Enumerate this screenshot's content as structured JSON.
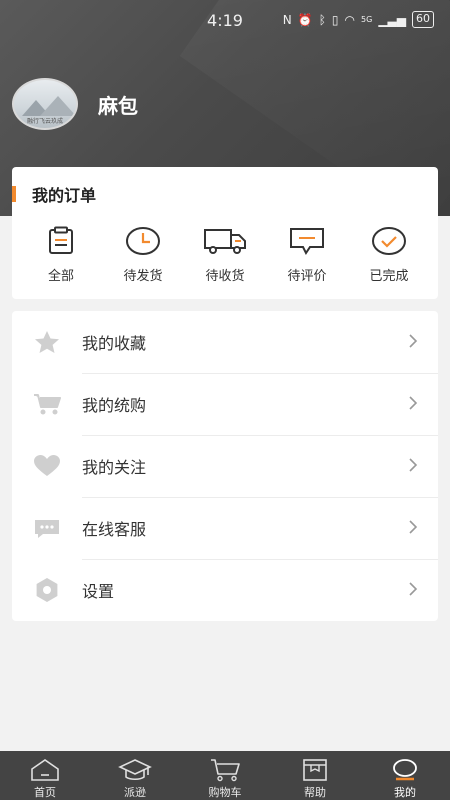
{
  "status_bar": {
    "time": "4:19",
    "network": "5G",
    "battery": "60"
  },
  "profile": {
    "avatar_caption": "融行飞云玖成",
    "username": "麻包"
  },
  "orders": {
    "title": "我的订单",
    "items": [
      {
        "label": "全部",
        "icon": "clipboard-icon"
      },
      {
        "label": "待发货",
        "icon": "clock-icon"
      },
      {
        "label": "待收货",
        "icon": "truck-icon"
      },
      {
        "label": "待评价",
        "icon": "comment-icon"
      },
      {
        "label": "已完成",
        "icon": "check-circle-icon"
      }
    ]
  },
  "menu": {
    "items": [
      {
        "label": "我的收藏",
        "icon": "star-icon"
      },
      {
        "label": "我的统购",
        "icon": "cart-icon"
      },
      {
        "label": "我的关注",
        "icon": "heart-icon"
      },
      {
        "label": "在线客服",
        "icon": "chat-icon"
      },
      {
        "label": "设置",
        "icon": "settings-icon"
      }
    ]
  },
  "tabbar": {
    "items": [
      {
        "label": "首页",
        "icon": "home-icon"
      },
      {
        "label": "派逊",
        "icon": "graduation-cap-icon"
      },
      {
        "label": "购物车",
        "icon": "cart-icon"
      },
      {
        "label": "帮助",
        "icon": "help-box-icon"
      },
      {
        "label": "我的",
        "icon": "profile-icon",
        "active": true
      }
    ]
  },
  "colors": {
    "accent": "#f28a2e",
    "header": "#4a4a4a",
    "tabbar": "#444444",
    "icon_gray": "#cfcfcf"
  }
}
